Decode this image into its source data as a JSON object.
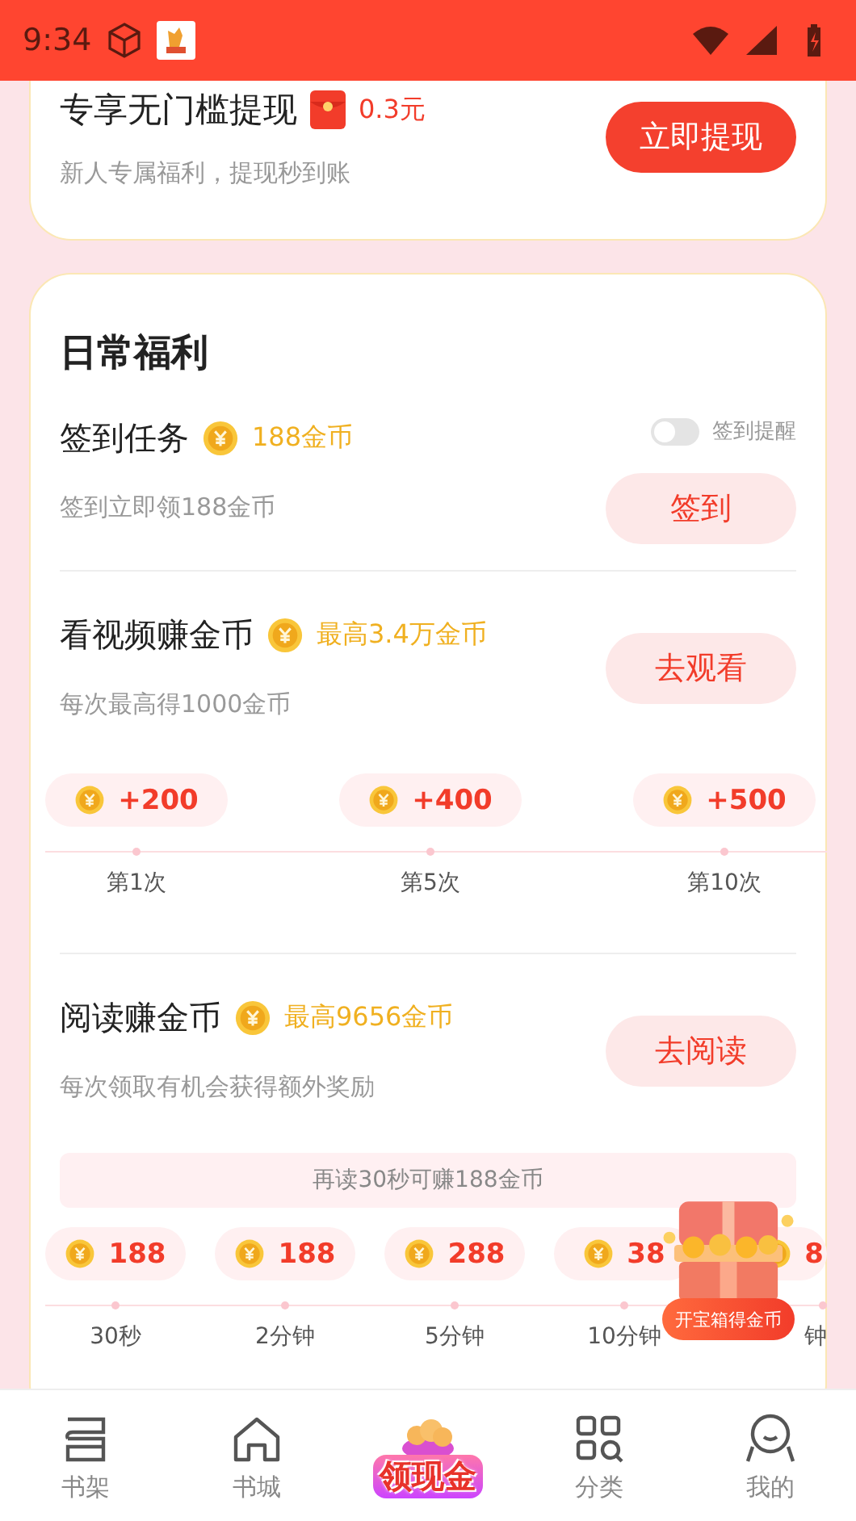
{
  "status_bar": {
    "time": "9:34"
  },
  "withdraw_card": {
    "title": "专享无门槛提现",
    "amount": "0.3元",
    "subtitle": "新人专属福利，提现秒到账",
    "button": "立即提现"
  },
  "daily": {
    "heading": "日常福利",
    "tasks": [
      {
        "title": "签到任务",
        "reward": "188金币",
        "subtitle": "签到立即领188金币",
        "button": "签到",
        "reminder": {
          "label": "签到提醒",
          "on": false
        }
      },
      {
        "title": "看视频赚金币",
        "reward": "最高3.4万金币",
        "subtitle": "每次最高得1000金币",
        "button": "去观看",
        "milestones": [
          {
            "value": "+200",
            "label": "第1次"
          },
          {
            "value": "+400",
            "label": "第5次"
          },
          {
            "value": "+500",
            "label": "第10次"
          }
        ]
      },
      {
        "title": "阅读赚金币",
        "reward": "最高9656金币",
        "subtitle": "每次领取有机会获得额外奖励",
        "button": "去阅读",
        "banner": "再读30秒可赚188金币",
        "milestones": [
          {
            "value": "188",
            "label": "30秒"
          },
          {
            "value": "188",
            "label": "2分钟"
          },
          {
            "value": "288",
            "label": "5分钟"
          },
          {
            "value": "38",
            "label": "10分钟"
          },
          {
            "value": "8",
            "label": "钟"
          }
        ]
      }
    ],
    "chest_button": "开宝箱得金币"
  },
  "nav": [
    {
      "kind": "shelf",
      "label": "书架"
    },
    {
      "kind": "store",
      "label": "书城"
    },
    {
      "kind": "cash",
      "label": "领现金"
    },
    {
      "kind": "category",
      "label": "分类"
    },
    {
      "kind": "profile",
      "label": "我的"
    }
  ]
}
